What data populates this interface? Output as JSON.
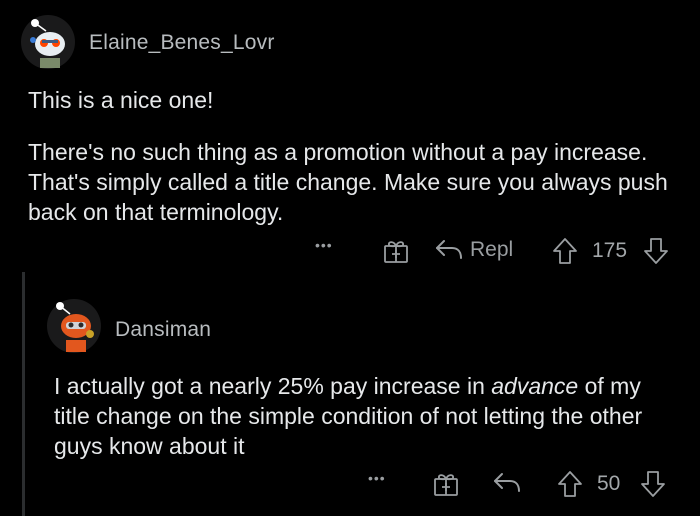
{
  "comments": [
    {
      "username": "Elaine_Benes_Lovr",
      "paragraphs": [
        "This is a nice one!",
        "There's no such thing as a promotion without a pay increase. That's simply called a title change. Make sure you always push back on that terminology."
      ],
      "actions": {
        "more": "•••",
        "reply_label": "Repl",
        "score": "175"
      }
    },
    {
      "username": "Dansiman",
      "text_before": "I actually got a nearly 25% pay increase in ",
      "text_emphasis": "advance",
      "text_after": " of my title change on the simple condition of not letting the other guys know about it",
      "actions": {
        "more": "•••",
        "score": "50"
      }
    }
  ],
  "colors": {
    "background": "#000000",
    "text": "#e6e8ea",
    "muted": "#9a9ea1",
    "thread_line": "#2b2d2f"
  }
}
